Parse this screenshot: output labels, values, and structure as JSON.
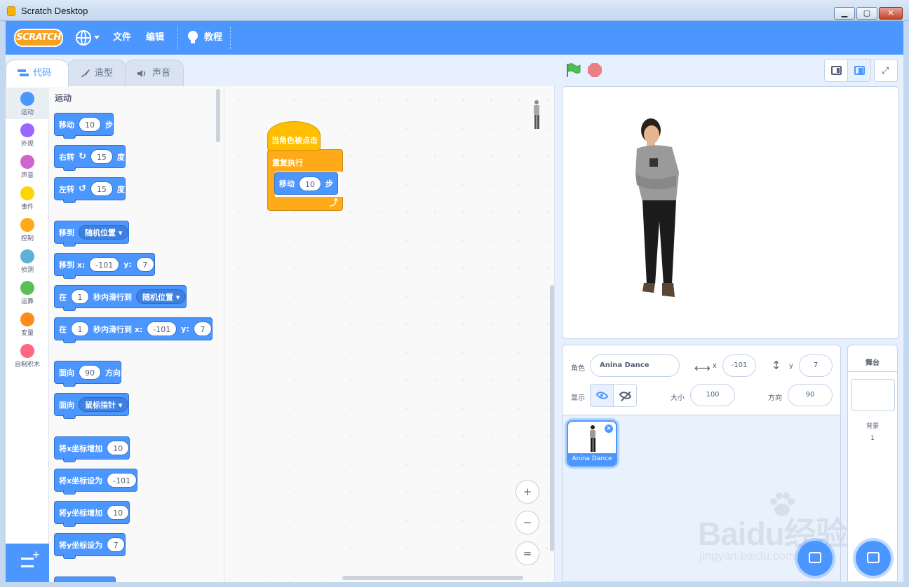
{
  "window": {
    "title": "Scratch Desktop",
    "min": "▁",
    "max": "▢",
    "close": "✕"
  },
  "menubar": {
    "logo": "SCRATCH",
    "file": "文件",
    "edit": "编辑",
    "tutorials": "教程",
    "accent": "#4c97ff"
  },
  "tabs": [
    {
      "label": "代码",
      "icon": "code-icon",
      "active": true
    },
    {
      "label": "造型",
      "icon": "brush-icon",
      "active": false
    },
    {
      "label": "声音",
      "icon": "speaker-icon",
      "active": false
    }
  ],
  "categories": [
    {
      "label": "运动",
      "color": "#4c97ff",
      "selected": true
    },
    {
      "label": "外观",
      "color": "#9966ff"
    },
    {
      "label": "声音",
      "color": "#cf63cf"
    },
    {
      "label": "事件",
      "color": "#ffd500"
    },
    {
      "label": "控制",
      "color": "#ffab19"
    },
    {
      "label": "侦测",
      "color": "#5cb1d6"
    },
    {
      "label": "运算",
      "color": "#59c059"
    },
    {
      "label": "变量",
      "color": "#ff8c1a"
    },
    {
      "label": "自制积木",
      "color": "#ff6680"
    }
  ],
  "palette": {
    "title": "运动",
    "blocks": {
      "move": {
        "a": "移动",
        "v": "10",
        "b": "步"
      },
      "turn_right": {
        "a": "右转",
        "v": "15",
        "b": "度"
      },
      "turn_left": {
        "a": "左转",
        "v": "15",
        "b": "度"
      },
      "goto": {
        "a": "移到",
        "dd": "随机位置"
      },
      "goto_xy": {
        "a": "移到 x:",
        "x": "-101",
        "b": "y:",
        "y": "7"
      },
      "glide": {
        "a": "在",
        "v": "1",
        "b": "秒内滑行到",
        "dd": "随机位置"
      },
      "glide_xy": {
        "a": "在",
        "v": "1",
        "b": "秒内滑行到 x:",
        "x": "-101",
        "c": "y:",
        "y": "7"
      },
      "point_dir": {
        "a": "面向",
        "v": "90",
        "b": "方向"
      },
      "point_towards": {
        "a": "面向",
        "dd": "鼠标指针"
      },
      "change_x": {
        "a": "将x坐标增加",
        "v": "10"
      },
      "set_x": {
        "a": "将x坐标设为",
        "v": "-101"
      },
      "change_y": {
        "a": "将y坐标增加",
        "v": "10"
      },
      "set_y": {
        "a": "将y坐标设为",
        "v": "7"
      }
    }
  },
  "script": {
    "hat": "当角色被点击",
    "forever": "重复执行",
    "move": "移动",
    "move_value": "10",
    "move_unit": "步"
  },
  "zoom": {
    "in": "+",
    "out": "−",
    "reset": "="
  },
  "sprite_info": {
    "sprite_label": "角色",
    "sprite_name": "Anina Dance",
    "x_label": "x",
    "x_value": "-101",
    "y_label": "y",
    "y_value": "7",
    "show_label": "显示",
    "size_label": "大小",
    "size_value": "100",
    "direction_label": "方向",
    "direction_value": "90"
  },
  "sprites": [
    {
      "name": "Anina Dance",
      "selected": true
    }
  ],
  "stage_panel": {
    "title": "舞台",
    "backdrops_label": "背景",
    "backdrops_count": "1"
  },
  "watermark": {
    "main": "Baidu经验",
    "sub": "jingyan.baidu.com"
  }
}
